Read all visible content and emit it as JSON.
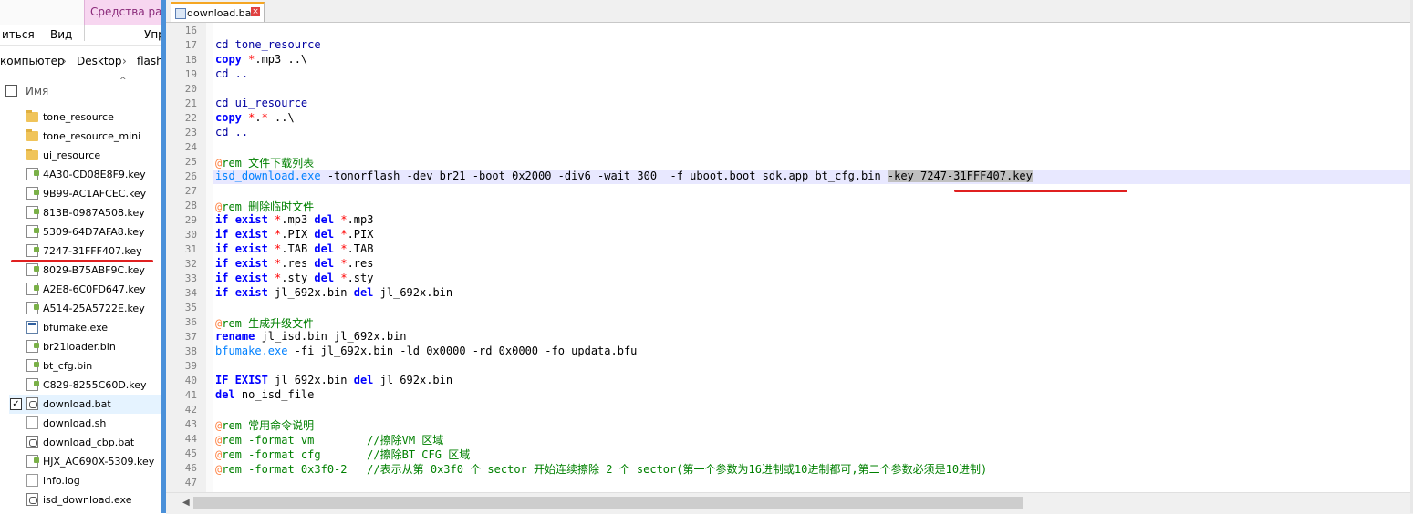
{
  "explorer": {
    "ribbon_context_tab": "Средства рабо",
    "ribbon_items": [
      "ить ся",
      "Вид",
      "Упр"
    ],
    "ribbon_item_share": "иться",
    "ribbon_item_view": "Вид",
    "ribbon_item_manage": "Упр",
    "breadcrumb": [
      "компьютер",
      "Desktop",
      "flash"
    ],
    "column_name": "Имя",
    "files": [
      {
        "name": "tone_resource",
        "type": "folder"
      },
      {
        "name": "tone_resource_mini",
        "type": "folder"
      },
      {
        "name": "ui_resource",
        "type": "folder"
      },
      {
        "name": "4A30-CD08E8F9.key",
        "type": "key"
      },
      {
        "name": "9B99-AC1AFCEC.key",
        "type": "key"
      },
      {
        "name": "813B-0987A508.key",
        "type": "key"
      },
      {
        "name": "5309-64D7AFA8.key",
        "type": "key"
      },
      {
        "name": "7247-31FFF407.key",
        "type": "key"
      },
      {
        "name": "8029-B75ABF9C.key",
        "type": "key"
      },
      {
        "name": "A2E8-6C0FD647.key",
        "type": "key"
      },
      {
        "name": "A514-25A5722E.key",
        "type": "key"
      },
      {
        "name": "bfumake.exe",
        "type": "exe"
      },
      {
        "name": "br21loader.bin",
        "type": "key"
      },
      {
        "name": "bt_cfg.bin",
        "type": "key"
      },
      {
        "name": "C829-8255C60D.key",
        "type": "key"
      },
      {
        "name": "download.bat",
        "type": "bat",
        "selected": true
      },
      {
        "name": "download.sh",
        "type": "doc"
      },
      {
        "name": "download_cbp.bat",
        "type": "bat"
      },
      {
        "name": "HJX_AC690X-5309.key",
        "type": "key"
      },
      {
        "name": "info.log",
        "type": "doc"
      },
      {
        "name": "isd_download.exe",
        "type": "bat"
      }
    ]
  },
  "editor": {
    "tab_label": "download.bat",
    "line_numbers": [
      "16",
      "17",
      "18",
      "19",
      "20",
      "21",
      "22",
      "23",
      "24",
      "25",
      "26",
      "27",
      "28",
      "29",
      "30",
      "31",
      "32",
      "33",
      "34",
      "35",
      "36",
      "37",
      "38",
      "39",
      "40",
      "41",
      "42",
      "43",
      "44",
      "45",
      "46",
      "47"
    ],
    "lines": {
      "l17": "cd tone_resource",
      "l18a": "copy ",
      "l18b": "*",
      "l18c": ".mp3 ..\\",
      "l19": "cd ..",
      "l21": "cd ui_resource",
      "l22a": "copy ",
      "l22b": "*",
      "l22c": ".",
      "l22d": "*",
      "l22e": " ..\\",
      "l23": "cd ..",
      "l25a": "@",
      "l25b": "rem 文件下载列表",
      "l26a": "isd_download.exe",
      "l26b": " -tonorflash -dev br21 -boot 0x2000 -div6 -wait 300  -f uboot.boot sdk.app bt_cfg.bin ",
      "l26c": "-key 7247-31FFF407.key",
      "l28a": "@",
      "l28b": "rem 删除临时文件",
      "if": "if",
      "exist": "exist",
      "del": "del",
      "l29": ".mp3",
      "l30": ".PIX",
      "l31": ".TAB",
      "l32": ".res",
      "l33": ".sty",
      "l34a": " jl_692x.bin ",
      "l34b": " jl_692x.bin",
      "l36a": "@",
      "l36b": "rem 生成升级文件",
      "l37a": "rename",
      "l37b": " jl_isd.bin jl_692x.bin",
      "l38a": "bfumake.exe",
      "l38b": " -fi jl_692x.bin -ld 0x0000 -rd 0x0000 -fo updata.bfu",
      "l40a": "IF EXIST",
      "l40b": " jl_692x.bin ",
      "l40c": "del",
      "l40d": " jl_692x.bin",
      "l41a": "del",
      "l41b": " no_isd_file",
      "l43a": "@",
      "l43b": "rem 常用命令说明",
      "l44a": "@",
      "l44b": "rem -format vm        //擦除VM 区域",
      "l45a": "@",
      "l45b": "rem -format cfg       //擦除BT CFG 区域",
      "l46a": "@",
      "l46b": "rem -format 0x3f0-2   //表示从第 0x3f0 个 sector 开始连续擦除 2 个 sector(第一个参数为16进制或10进制都可,第二个参数必须是10进制)"
    }
  },
  "colors": {
    "keyword": "#0000ff",
    "comment": "#008000",
    "at_sign": "#ff8040",
    "star": "#ff0000",
    "exe": "#0080ff",
    "annotation_red": "#e02020",
    "accent_blue": "#4a90d9"
  }
}
